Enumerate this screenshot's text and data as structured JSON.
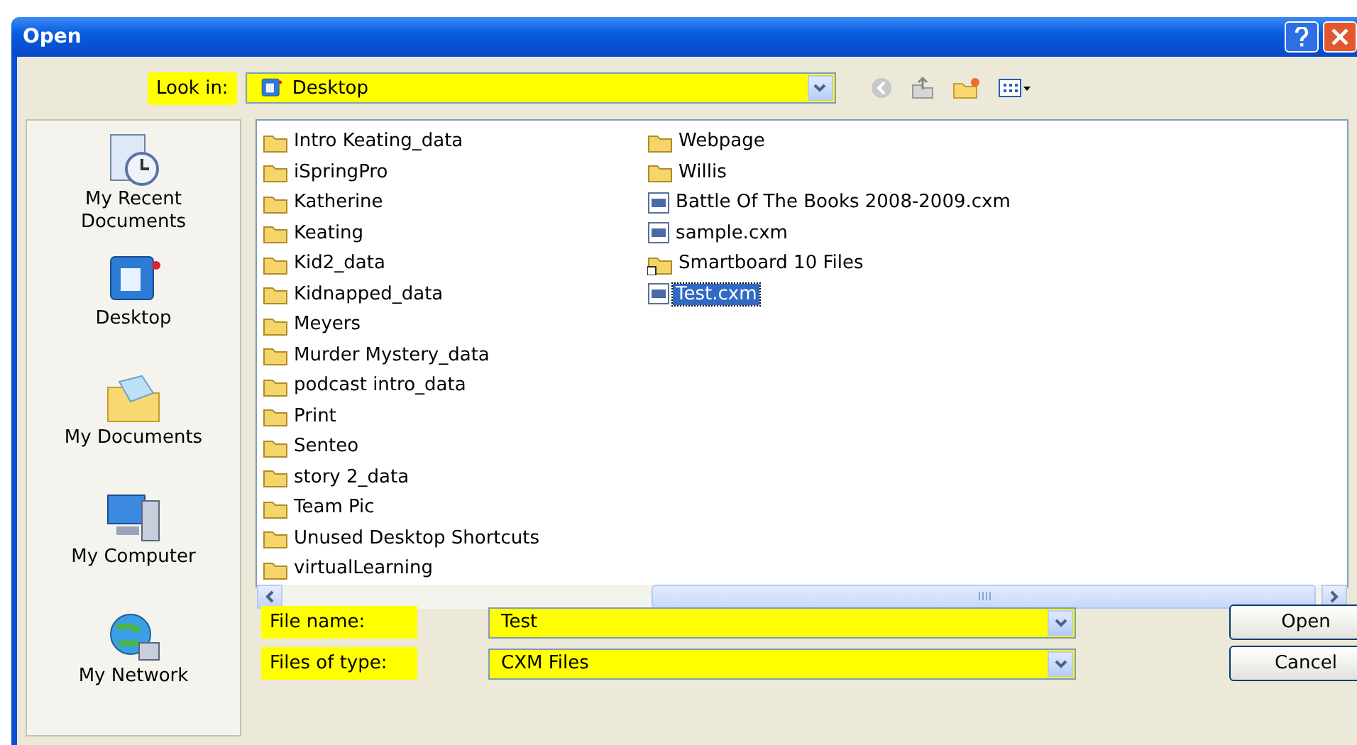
{
  "window": {
    "title": "Open"
  },
  "look_in": {
    "label": "Look in:",
    "value": "Desktop"
  },
  "places": [
    {
      "label": "My Recent Documents",
      "kind": "recent"
    },
    {
      "label": "Desktop",
      "kind": "desktop"
    },
    {
      "label": "My Documents",
      "kind": "documents"
    },
    {
      "label": "My Computer",
      "kind": "computer"
    },
    {
      "label": "My Network",
      "kind": "network"
    }
  ],
  "file_columns": [
    [
      {
        "name": "Intro Keating_data",
        "kind": "folder",
        "selected": false
      },
      {
        "name": "iSpringPro",
        "kind": "folder",
        "selected": false
      },
      {
        "name": "Katherine",
        "kind": "folder",
        "selected": false
      },
      {
        "name": "Keating",
        "kind": "folder",
        "selected": false
      },
      {
        "name": "Kid2_data",
        "kind": "folder",
        "selected": false
      },
      {
        "name": "Kidnapped_data",
        "kind": "folder",
        "selected": false
      },
      {
        "name": "Meyers",
        "kind": "folder",
        "selected": false
      },
      {
        "name": "Murder Mystery_data",
        "kind": "folder",
        "selected": false
      },
      {
        "name": "podcast intro_data",
        "kind": "folder",
        "selected": false
      },
      {
        "name": "Print",
        "kind": "folder",
        "selected": false
      },
      {
        "name": "Senteo",
        "kind": "folder",
        "selected": false
      },
      {
        "name": "story 2_data",
        "kind": "folder",
        "selected": false
      },
      {
        "name": "Team Pic",
        "kind": "folder",
        "selected": false
      },
      {
        "name": "Unused Desktop Shortcuts",
        "kind": "folder",
        "selected": false
      },
      {
        "name": "virtualLearning",
        "kind": "folder",
        "selected": false
      }
    ],
    [
      {
        "name": "Webpage",
        "kind": "folder",
        "selected": false
      },
      {
        "name": "Willis",
        "kind": "folder",
        "selected": false
      },
      {
        "name": "Battle Of The Books 2008-2009.cxm",
        "kind": "file",
        "selected": false
      },
      {
        "name": "sample.cxm",
        "kind": "file",
        "selected": false
      },
      {
        "name": "Smartboard 10 Files",
        "kind": "shortcut",
        "selected": false
      },
      {
        "name": "Test.cxm",
        "kind": "file",
        "selected": true
      }
    ]
  ],
  "file_name": {
    "label": "File name:",
    "value": "Test"
  },
  "file_type": {
    "label": "Files of type:",
    "value": "CXM Files"
  },
  "buttons": [
    "Open",
    "Cancel"
  ]
}
